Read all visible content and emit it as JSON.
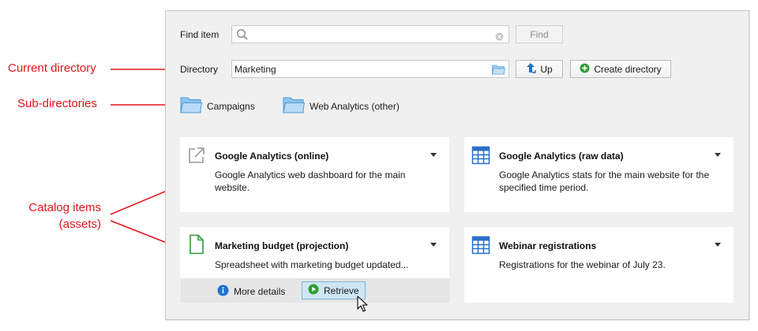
{
  "annotations": {
    "current_directory": "Current directory",
    "sub_directories": "Sub-directories",
    "catalog_items_line1": "Catalog items",
    "catalog_items_line2": "(assets)"
  },
  "find": {
    "label": "Find item",
    "search_value": "",
    "button_label": "Find"
  },
  "directory": {
    "label": "Directory",
    "value": "Marketing",
    "up_label": "Up",
    "create_label": "Create directory"
  },
  "subdirectories": [
    {
      "label": "Campaigns"
    },
    {
      "label": "Web Analytics (other)"
    }
  ],
  "items": [
    {
      "title": "Google Analytics (online)",
      "description": "Google Analytics web dashboard for the main website.",
      "icon": "external-link-icon"
    },
    {
      "title": "Google Analytics (raw data)",
      "description": "Google Analytics stats for the main website for the specified time period.",
      "icon": "table-icon"
    },
    {
      "title": "Marketing budget (projection)",
      "description": "Spreadsheet with marketing budget updated...",
      "icon": "document-icon"
    },
    {
      "title": "Webinar registrations",
      "description": "Registrations for the webinar of July 23.",
      "icon": "table-icon"
    }
  ],
  "item_actions": {
    "more_details_label": "More details",
    "retrieve_label": "Retrieve"
  },
  "colors": {
    "annotation": "#e0151b",
    "panel_bg": "#f0f0f0",
    "table_icon": "#2a6fc9",
    "document_icon": "#2e9e38",
    "info_icon": "#1e73d0",
    "retrieve_icon": "#2e9e38"
  }
}
